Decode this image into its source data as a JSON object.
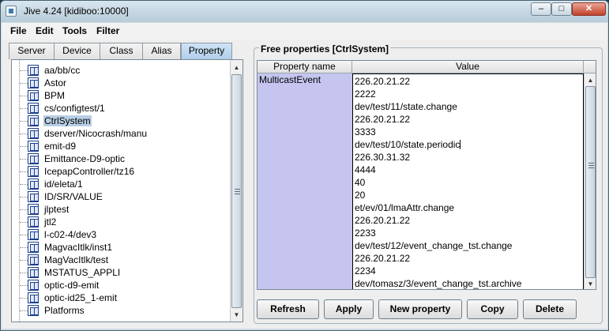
{
  "window": {
    "title": "Jive 4.24  [kidiboo:10000]"
  },
  "menu": [
    "File",
    "Edit",
    "Tools",
    "Filter"
  ],
  "tabs": [
    "Server",
    "Device",
    "Class",
    "Alias",
    "Property"
  ],
  "active_tab": "Property",
  "tree": {
    "items": [
      "aa/bb/cc",
      "Astor",
      "BPM",
      "cs/configtest/1",
      "CtrlSystem",
      "dserver/Nicocrash/manu",
      "emit-d9",
      "Emittance-D9-optic",
      "IcepapController/tz16",
      "id/eleta/1",
      "ID/SR/VALUE",
      "jlptest",
      "jtl2",
      "l-c02-4/dev3",
      "MagvacItlk/inst1",
      "MagVacItlk/test",
      "MSTATUS_APPLI",
      "optic-d9-emit",
      "optic-id25_1-emit",
      "Platforms"
    ],
    "selected": "CtrlSystem"
  },
  "properties": {
    "group_title": "Free properties [CtrlSystem]",
    "col_name": "Property name",
    "col_value": "Value",
    "name": "MulticastEvent",
    "value_lines": [
      "226.20.21.22",
      "2222",
      "dev/test/11/state.change",
      "226.20.21.22",
      "3333",
      "dev/test/10/state.periodic",
      "226.30.31.32",
      "4444",
      "40",
      "20",
      "et/ev/01/lmaAttr.change",
      "226.20.21.22",
      "2233",
      "dev/test/12/event_change_tst.change",
      "226.20.21.22",
      "2234",
      "dev/tomasz/3/event_change_tst.archive"
    ]
  },
  "buttons": {
    "refresh": "Refresh",
    "apply": "Apply",
    "new_property": "New property",
    "copy": "Copy",
    "delete": "Delete"
  }
}
